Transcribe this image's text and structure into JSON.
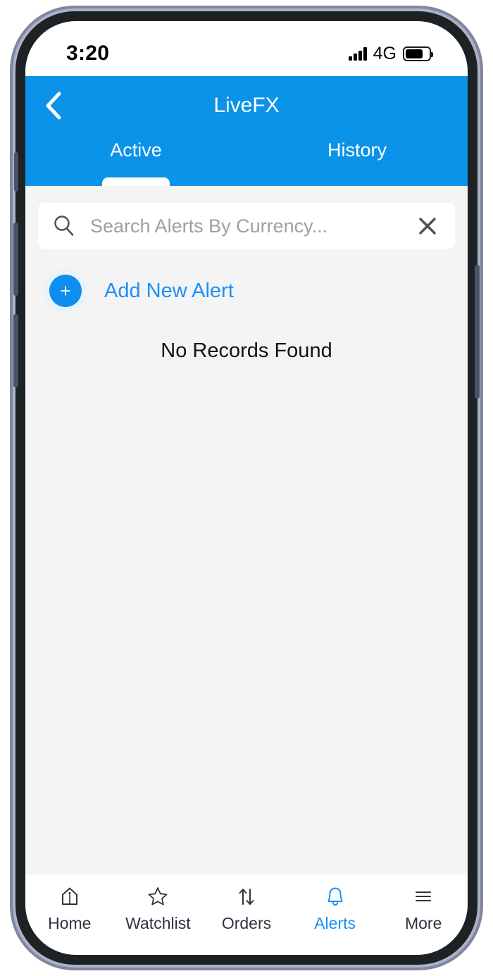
{
  "status_bar": {
    "time": "3:20",
    "network_type": "4G",
    "battery_level_pct": 75,
    "signal_bars": 4
  },
  "header": {
    "title": "LiveFX",
    "back_label": "Back",
    "tabs": [
      {
        "label": "Active",
        "active": true
      },
      {
        "label": "History",
        "active": false
      }
    ]
  },
  "search": {
    "placeholder": "Search Alerts By Currency...",
    "value": "",
    "clear_label": "Clear"
  },
  "actions": {
    "add_new_alert_label": "Add New Alert",
    "add_icon_glyph": "+"
  },
  "list": {
    "empty_message": "No Records Found"
  },
  "bottom_nav": {
    "items": [
      {
        "label": "Home",
        "icon": "home-icon",
        "active": false
      },
      {
        "label": "Watchlist",
        "icon": "star-icon",
        "active": false
      },
      {
        "label": "Orders",
        "icon": "swap-arrows-icon",
        "active": false
      },
      {
        "label": "Alerts",
        "icon": "bell-icon",
        "active": true
      },
      {
        "label": "More",
        "icon": "hamburger-icon",
        "active": false
      }
    ]
  },
  "colors": {
    "brand_blue": "#0a93e8",
    "accent_blue": "#1b90f5",
    "content_background": "#f4f4f5",
    "nav_inactive": "#2f3440"
  }
}
